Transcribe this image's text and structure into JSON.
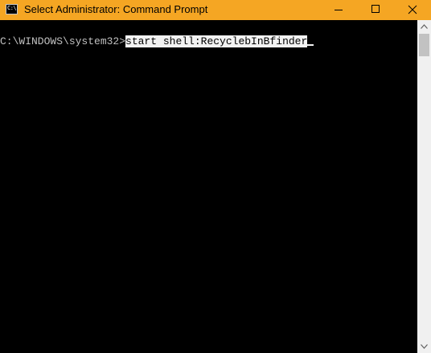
{
  "window": {
    "title": "Select Administrator: Command Prompt",
    "icon_glyph": "C:\\",
    "icon": "cmd-icon"
  },
  "controls": {
    "minimize_icon": "minimize-icon",
    "maximize_icon": "maximize-icon",
    "close_icon": "close-icon"
  },
  "console": {
    "prompt": "C:\\WINDOWS\\system32>",
    "selected_command": "start shell:RecyclebInBfinder",
    "text_color": "#c0c0c0",
    "background": "#000000",
    "selection_color": "#f2f2f2"
  },
  "titlebar": {
    "background": "#f5a623"
  }
}
